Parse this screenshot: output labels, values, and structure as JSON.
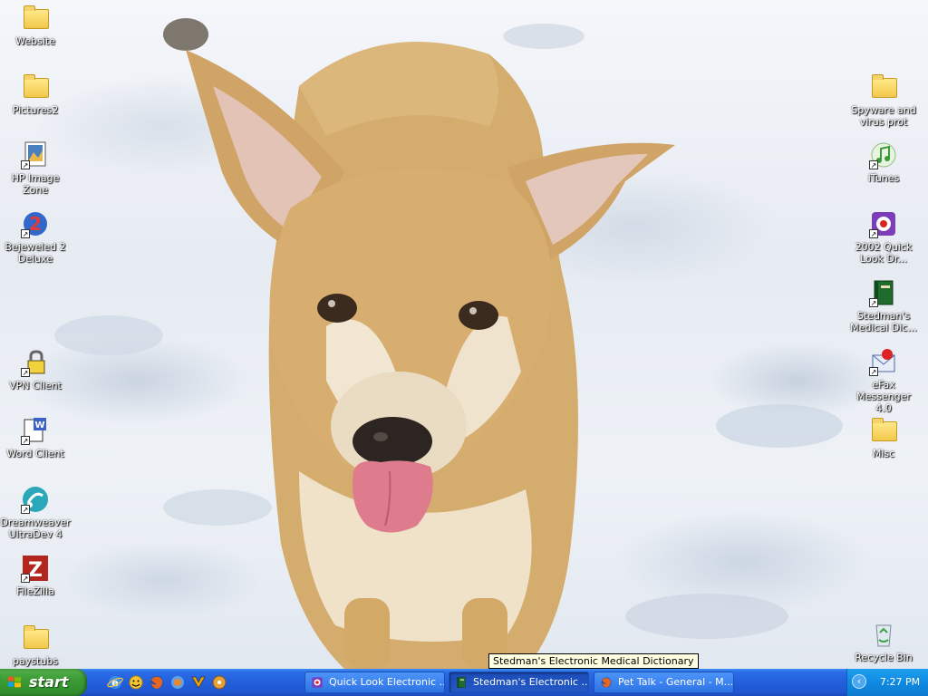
{
  "desktop": {
    "left_icons": [
      {
        "label": "Website",
        "icon": "folder-icon",
        "shortcut": false
      },
      {
        "label": "Pictures2",
        "icon": "folder-icon",
        "shortcut": false
      },
      {
        "label": "HP  Image Zone",
        "icon": "hp-image-zone-icon",
        "shortcut": true
      },
      {
        "label": "Bejeweled 2 Deluxe",
        "icon": "bejeweled-icon",
        "shortcut": true
      },
      {
        "label": "VPN Client",
        "icon": "vpn-lock-icon",
        "shortcut": true
      },
      {
        "label": "Word Client",
        "icon": "word-client-icon",
        "shortcut": true
      },
      {
        "label": "Dreamweaver UltraDev 4",
        "icon": "dreamweaver-icon",
        "shortcut": true
      },
      {
        "label": "FileZilla",
        "icon": "filezilla-icon",
        "shortcut": true
      },
      {
        "label": "paystubs",
        "icon": "folder-icon",
        "shortcut": false
      }
    ],
    "right_icons": [
      {
        "label": "Spyware and virus prot",
        "icon": "folder-icon",
        "shortcut": false
      },
      {
        "label": "iTunes",
        "icon": "itunes-icon",
        "shortcut": true
      },
      {
        "label": "2002 Quick Look Dr...",
        "icon": "quick-look-icon",
        "shortcut": true
      },
      {
        "label": "Stedman's Medical Dic...",
        "icon": "stedmans-book-icon",
        "shortcut": true
      },
      {
        "label": "eFax Messenger 4.0",
        "icon": "efax-icon",
        "shortcut": true
      },
      {
        "label": "Misc",
        "icon": "folder-icon",
        "shortcut": false
      },
      {
        "label": "Recycle Bin",
        "icon": "recycle-bin-icon",
        "shortcut": false
      }
    ]
  },
  "tooltip": "Stedman's Electronic Medical Dictionary",
  "taskbar": {
    "start_label": "start",
    "quick_launch": [
      "internet-explorer-icon",
      "messenger-icon",
      "firefox-icon",
      "browser-icon",
      "winamp-icon",
      "media-icon"
    ],
    "buttons": [
      {
        "label": "Quick Look Electronic ...",
        "icon": "quick-look-icon",
        "active": false
      },
      {
        "label": "Stedman's Electronic ...",
        "icon": "stedmans-book-icon",
        "active": true
      },
      {
        "label": "Pet Talk - General - M...",
        "icon": "firefox-icon",
        "active": false
      }
    ],
    "clock": "7:27 PM"
  },
  "colors": {
    "taskbar_blue": "#245edb",
    "start_green": "#3c9b35",
    "tray_blue": "#108ae0",
    "tooltip_bg": "#ffffe1"
  }
}
